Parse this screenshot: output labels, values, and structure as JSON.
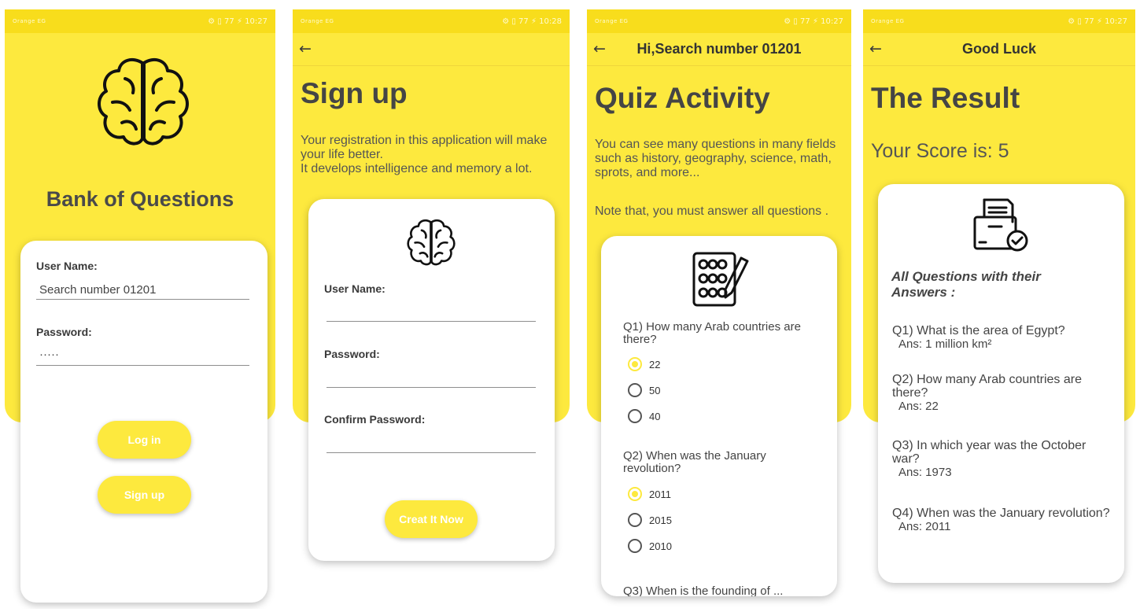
{
  "status": {
    "carrier": "Orange EG",
    "time1": "10:27",
    "time2": "10:28",
    "icons": "⚙ ▯ 77 ⚡"
  },
  "login": {
    "app_title": "Bank of Questions",
    "username_label": "User Name:",
    "username_value": "Search number 01201",
    "password_label": "Password:",
    "password_value": "·····",
    "login_button": "Log in",
    "signup_button": "Sign up"
  },
  "signup": {
    "title": "Sign up",
    "description": "Your registration in this application will make your life better.\nIt develops intelligence and memory a lot.",
    "username_label": "User Name:",
    "password_label": "Password:",
    "confirm_label": "Confirm Password:",
    "create_button": "Creat It Now"
  },
  "quiz": {
    "appbar_title": "Hi,Search number 01201",
    "title": "Quiz Activity",
    "description": "You can see many questions in many fields such as history, geography, science, math, sprots, and more...",
    "note": "Note that, you must answer all questions .",
    "q1": {
      "text": "Q1) How many Arab countries are there?",
      "options": [
        "22",
        "50",
        "40"
      ],
      "selected": 0
    },
    "q2": {
      "text": "Q2) When was the January revolution?",
      "options": [
        "2011",
        "2015",
        "2010"
      ],
      "selected": 0
    },
    "q3_partial": "Q3) When is the founding of ..."
  },
  "result": {
    "appbar_title": "Good Luck",
    "title": "The Result",
    "score": "Your Score is: 5",
    "heading": "All Questions with their Answers :",
    "items": [
      {
        "q": "Q1) What is the area of Egypt?",
        "a": "Ans: 1 million km²"
      },
      {
        "q": "Q2) How many Arab countries are there?",
        "a": "Ans: 22"
      },
      {
        "q": "Q3) In which year was the October war?",
        "a": "Ans: 1973"
      },
      {
        "q": "Q4) When was the January revolution?",
        "a": "Ans: 2011"
      }
    ]
  },
  "colors": {
    "yellow": "#fde93e",
    "status_yellow": "#f8dd1c"
  }
}
